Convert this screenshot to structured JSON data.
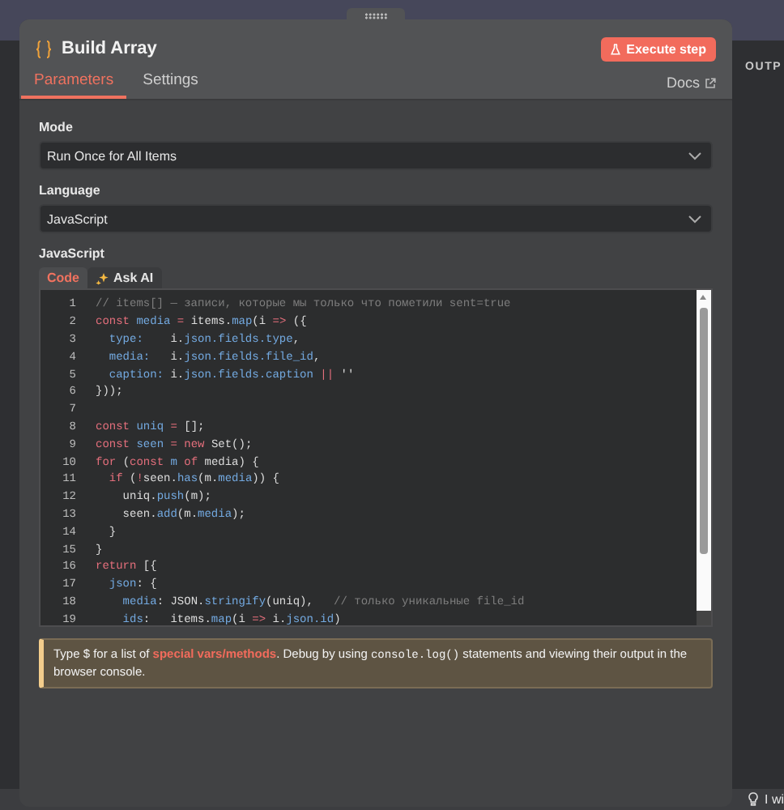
{
  "canvas": {
    "output_label": "OUTP",
    "hint": "I wi"
  },
  "node": {
    "title": "Build Array",
    "execute_button": "Execute step",
    "tabs": [
      {
        "label": "Parameters",
        "selected": true
      },
      {
        "label": "Settings",
        "selected": false
      }
    ],
    "docs_link": "Docs",
    "fields": [
      {
        "label": "Mode",
        "value": "Run Once for All Items"
      },
      {
        "label": "Language",
        "value": "JavaScript"
      }
    ],
    "editor": {
      "label": "JavaScript",
      "tabs": [
        {
          "label": "Code",
          "selected": true,
          "kind": "code"
        },
        {
          "label": "Ask AI",
          "selected": false,
          "kind": "ai"
        }
      ],
      "lines": [
        {
          "number": "1",
          "tokens": [
            {
              "kind": "comment",
              "text": "// items[] — записи, которые мы только что пометили sent=true"
            }
          ]
        },
        {
          "number": "2",
          "tokens": [
            {
              "kind": "kw",
              "text": "const "
            },
            {
              "kind": "def",
              "text": "media"
            },
            {
              "kind": "op",
              "text": " = "
            },
            {
              "kind": "plain",
              "text": "items."
            },
            {
              "kind": "def",
              "text": "map"
            },
            {
              "kind": "plain",
              "text": "(i "
            },
            {
              "kind": "op",
              "text": "=>"
            },
            {
              "kind": "plain",
              "text": " ({"
            }
          ]
        },
        {
          "number": "3",
          "tokens": [
            {
              "kind": "def",
              "text": "  type:"
            },
            {
              "kind": "plain",
              "text": "    i."
            },
            {
              "kind": "def",
              "text": "json.fields.type"
            },
            {
              "kind": "plain",
              "text": ","
            }
          ]
        },
        {
          "number": "4",
          "tokens": [
            {
              "kind": "def",
              "text": "  media:"
            },
            {
              "kind": "plain",
              "text": "   i."
            },
            {
              "kind": "def",
              "text": "json.fields.file_id"
            },
            {
              "kind": "plain",
              "text": ","
            }
          ]
        },
        {
          "number": "5",
          "tokens": [
            {
              "kind": "def",
              "text": "  caption:"
            },
            {
              "kind": "plain",
              "text": " i."
            },
            {
              "kind": "def",
              "text": "json.fields.caption"
            },
            {
              "kind": "op",
              "text": " ||"
            },
            {
              "kind": "plain",
              "text": " ''"
            }
          ]
        },
        {
          "number": "6",
          "tokens": [
            {
              "kind": "plain",
              "text": "}));"
            }
          ]
        },
        {
          "number": "7"
        },
        {
          "number": "8",
          "tokens": [
            {
              "kind": "kw",
              "text": "const "
            },
            {
              "kind": "def",
              "text": "uniq"
            },
            {
              "kind": "op",
              "text": " = "
            },
            {
              "kind": "plain",
              "text": "[];"
            }
          ]
        },
        {
          "number": "9",
          "tokens": [
            {
              "kind": "kw",
              "text": "const "
            },
            {
              "kind": "def",
              "text": "seen"
            },
            {
              "kind": "op",
              "text": " = "
            },
            {
              "kind": "kw",
              "text": "new "
            },
            {
              "kind": "plain",
              "text": "Set();"
            }
          ]
        },
        {
          "number": "10",
          "tokens": [
            {
              "kind": "kw",
              "text": "for "
            },
            {
              "kind": "plain",
              "text": "("
            },
            {
              "kind": "kw",
              "text": "const "
            },
            {
              "kind": "def",
              "text": "m"
            },
            {
              "kind": "kw",
              "text": " of "
            },
            {
              "kind": "plain",
              "text": "media) {"
            }
          ]
        },
        {
          "number": "11",
          "tokens": [
            {
              "kind": "kw",
              "text": "  if "
            },
            {
              "kind": "plain",
              "text": "("
            },
            {
              "kind": "op",
              "text": "!"
            },
            {
              "kind": "plain",
              "text": "seen."
            },
            {
              "kind": "def",
              "text": "has"
            },
            {
              "kind": "plain",
              "text": "(m."
            },
            {
              "kind": "def",
              "text": "media"
            },
            {
              "kind": "plain",
              "text": ")) {"
            }
          ]
        },
        {
          "number": "12",
          "tokens": [
            {
              "kind": "plain",
              "text": "    uniq."
            },
            {
              "kind": "def",
              "text": "push"
            },
            {
              "kind": "plain",
              "text": "(m);"
            }
          ]
        },
        {
          "number": "13",
          "tokens": [
            {
              "kind": "plain",
              "text": "    seen."
            },
            {
              "kind": "def",
              "text": "add"
            },
            {
              "kind": "plain",
              "text": "(m."
            },
            {
              "kind": "def",
              "text": "media"
            },
            {
              "kind": "plain",
              "text": ");"
            }
          ]
        },
        {
          "number": "14",
          "tokens": [
            {
              "kind": "plain",
              "text": "  }"
            }
          ]
        },
        {
          "number": "15",
          "tokens": [
            {
              "kind": "plain",
              "text": "}"
            }
          ]
        },
        {
          "number": "16",
          "tokens": [
            {
              "kind": "kw",
              "text": "return "
            },
            {
              "kind": "plain",
              "text": "[{"
            }
          ]
        },
        {
          "number": "17",
          "tokens": [
            {
              "kind": "def",
              "text": "  json"
            },
            {
              "kind": "plain",
              "text": ": {"
            }
          ]
        },
        {
          "number": "18",
          "tokens": [
            {
              "kind": "def",
              "text": "    media"
            },
            {
              "kind": "plain",
              "text": ": JSON."
            },
            {
              "kind": "def",
              "text": "stringify"
            },
            {
              "kind": "plain",
              "text": "(uniq),   "
            },
            {
              "kind": "comment",
              "text": "// только уникальные file_id"
            }
          ]
        },
        {
          "number": "19",
          "tokens": [
            {
              "kind": "def",
              "text": "    ids"
            },
            {
              "kind": "plain",
              "text": ":   items."
            },
            {
              "kind": "def",
              "text": "map"
            },
            {
              "kind": "plain",
              "text": "(i "
            },
            {
              "kind": "op",
              "text": "=>"
            },
            {
              "kind": "plain",
              "text": " i."
            },
            {
              "kind": "def",
              "text": "json.id"
            },
            {
              "kind": "plain",
              "text": ")"
            }
          ]
        }
      ]
    },
    "notice": [
      {
        "kind": "text",
        "text": "Type $ for a list of "
      },
      {
        "kind": "link",
        "text": "special vars/methods"
      },
      {
        "kind": "text",
        "text": ". Debug by using "
      },
      {
        "kind": "code",
        "text": "console.log()"
      },
      {
        "kind": "text",
        "text": " statements and viewing their output in the browser console."
      }
    ]
  }
}
